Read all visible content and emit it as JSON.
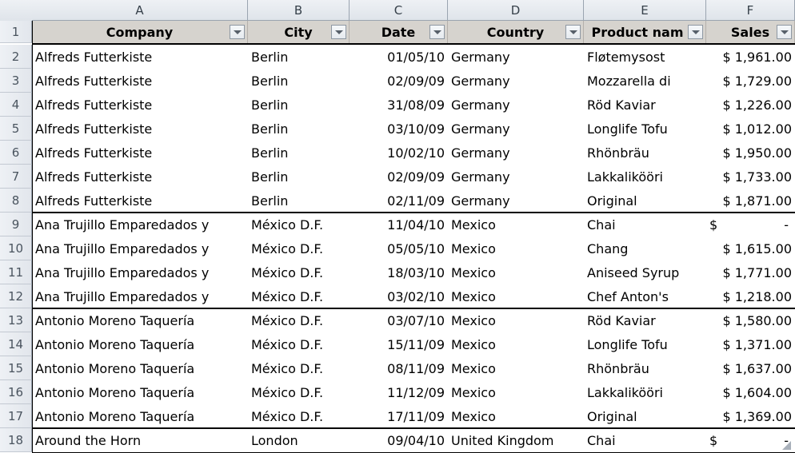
{
  "grid": {
    "corner_icon": "select-all-triangle-icon",
    "column_letters": [
      "A",
      "B",
      "C",
      "D",
      "E",
      "F"
    ],
    "row_numbers": [
      "1",
      "2",
      "3",
      "4",
      "5",
      "6",
      "7",
      "8",
      "9",
      "10",
      "11",
      "12",
      "13",
      "14",
      "15",
      "16",
      "17",
      "18"
    ]
  },
  "table": {
    "headers": [
      {
        "label": "Company",
        "filter_icon": "filter-dropdown-icon"
      },
      {
        "label": "City",
        "filter_icon": "filter-dropdown-icon"
      },
      {
        "label": "Date",
        "filter_icon": "filter-dropdown-icon"
      },
      {
        "label": "Country",
        "filter_icon": "filter-dropdown-icon"
      },
      {
        "label": "Product nam",
        "filter_icon": "filter-dropdown-icon"
      },
      {
        "label": "Sales",
        "filter_icon": "filter-dropdown-icon"
      }
    ],
    "rows": [
      {
        "row": "2",
        "company": "Alfreds Futterkiste",
        "city": "Berlin",
        "date": "01/05/10",
        "country": "Germany",
        "product": "Fløtemysost",
        "sales": "$ 1,961.00",
        "sales_zero": false
      },
      {
        "row": "3",
        "company": "Alfreds Futterkiste",
        "city": "Berlin",
        "date": "02/09/09",
        "country": "Germany",
        "product": "Mozzarella di",
        "sales": "$ 1,729.00",
        "sales_zero": false
      },
      {
        "row": "4",
        "company": "Alfreds Futterkiste",
        "city": "Berlin",
        "date": "31/08/09",
        "country": "Germany",
        "product": "Röd Kaviar",
        "sales": "$ 1,226.00",
        "sales_zero": false
      },
      {
        "row": "5",
        "company": "Alfreds Futterkiste",
        "city": "Berlin",
        "date": "03/10/09",
        "country": "Germany",
        "product": "Longlife Tofu",
        "sales": "$ 1,012.00",
        "sales_zero": false
      },
      {
        "row": "6",
        "company": "Alfreds Futterkiste",
        "city": "Berlin",
        "date": "10/02/10",
        "country": "Germany",
        "product": "Rhönbräu",
        "sales": "$ 1,950.00",
        "sales_zero": false
      },
      {
        "row": "7",
        "company": "Alfreds Futterkiste",
        "city": "Berlin",
        "date": "02/09/09",
        "country": "Germany",
        "product": "Lakkalikööri",
        "sales": "$ 1,733.00",
        "sales_zero": false
      },
      {
        "row": "8",
        "company": "Alfreds Futterkiste",
        "city": "Berlin",
        "date": "02/11/09",
        "country": "Germany",
        "product": "Original",
        "sales": "$ 1,871.00",
        "sales_zero": false,
        "group_end": true
      },
      {
        "row": "9",
        "company": "Ana Trujillo Emparedados y",
        "city": "México D.F.",
        "date": "11/04/10",
        "country": "Mexico",
        "product": "Chai",
        "sales": "$",
        "sales_dash": "-",
        "sales_zero": true
      },
      {
        "row": "10",
        "company": "Ana Trujillo Emparedados y",
        "city": "México D.F.",
        "date": "05/05/10",
        "country": "Mexico",
        "product": "Chang",
        "sales": "$ 1,615.00",
        "sales_zero": false
      },
      {
        "row": "11",
        "company": "Ana Trujillo Emparedados y",
        "city": "México D.F.",
        "date": "18/03/10",
        "country": "Mexico",
        "product": "Aniseed Syrup",
        "sales": "$ 1,771.00",
        "sales_zero": false
      },
      {
        "row": "12",
        "company": "Ana Trujillo Emparedados y",
        "city": "México D.F.",
        "date": "03/02/10",
        "country": "Mexico",
        "product": "Chef Anton's",
        "sales": "$ 1,218.00",
        "sales_zero": false,
        "group_end": true
      },
      {
        "row": "13",
        "company": "Antonio Moreno Taquería",
        "city": "México D.F.",
        "date": "03/07/10",
        "country": "Mexico",
        "product": "Röd Kaviar",
        "sales": "$ 1,580.00",
        "sales_zero": false
      },
      {
        "row": "14",
        "company": "Antonio Moreno Taquería",
        "city": "México D.F.",
        "date": "15/11/09",
        "country": "Mexico",
        "product": "Longlife Tofu",
        "sales": "$ 1,371.00",
        "sales_zero": false
      },
      {
        "row": "15",
        "company": "Antonio Moreno Taquería",
        "city": "México D.F.",
        "date": "08/11/09",
        "country": "Mexico",
        "product": "Rhönbräu",
        "sales": "$ 1,637.00",
        "sales_zero": false
      },
      {
        "row": "16",
        "company": "Antonio Moreno Taquería",
        "city": "México D.F.",
        "date": "11/12/09",
        "country": "Mexico",
        "product": "Lakkalikööri",
        "sales": "$ 1,604.00",
        "sales_zero": false
      },
      {
        "row": "17",
        "company": "Antonio Moreno Taquería",
        "city": "México D.F.",
        "date": "17/11/09",
        "country": "Mexico",
        "product": "Original",
        "sales": "$ 1,369.00",
        "sales_zero": false,
        "group_end": true
      },
      {
        "row": "18",
        "company": "Around the Horn",
        "city": "London",
        "date": "09/04/10",
        "country": "United Kingdom",
        "product": "Chai",
        "sales": "$",
        "sales_dash": "-",
        "sales_zero": true
      }
    ]
  }
}
